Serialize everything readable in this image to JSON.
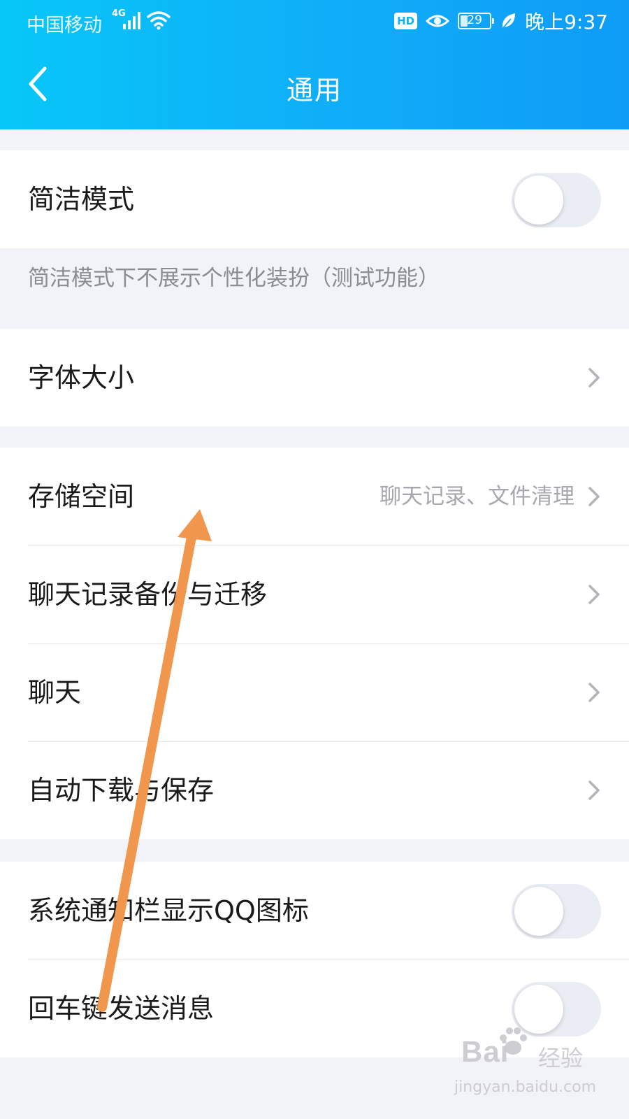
{
  "status_bar": {
    "carrier": "中国移动",
    "network": "4G",
    "battery": "29",
    "time": "晚上9:37",
    "hd": "HD"
  },
  "header": {
    "title": "通用"
  },
  "simple_mode": {
    "label": "简洁模式",
    "enabled": false,
    "note": "简洁模式下不展示个性化装扮（测试功能）"
  },
  "font_size": {
    "label": "字体大小"
  },
  "storage_group": [
    {
      "label": "存储空间",
      "sub": "聊天记录、文件清理"
    },
    {
      "label": "聊天记录备份与迁移",
      "sub": ""
    },
    {
      "label": "聊天",
      "sub": ""
    },
    {
      "label": "自动下载与保存",
      "sub": ""
    }
  ],
  "toggles_group": [
    {
      "label": "系统通知栏显示QQ图标",
      "enabled": false
    },
    {
      "label": "回车键发送消息",
      "enabled": false
    }
  ],
  "watermark": {
    "brand": "Bai",
    "brand_suffix": "经验",
    "url": "jingyan.baidu.com"
  },
  "colors": {
    "header_start": "#07c7f8",
    "header_end": "#0e9cf7",
    "arrow": "#f0964d",
    "background": "#f2f3f8"
  }
}
